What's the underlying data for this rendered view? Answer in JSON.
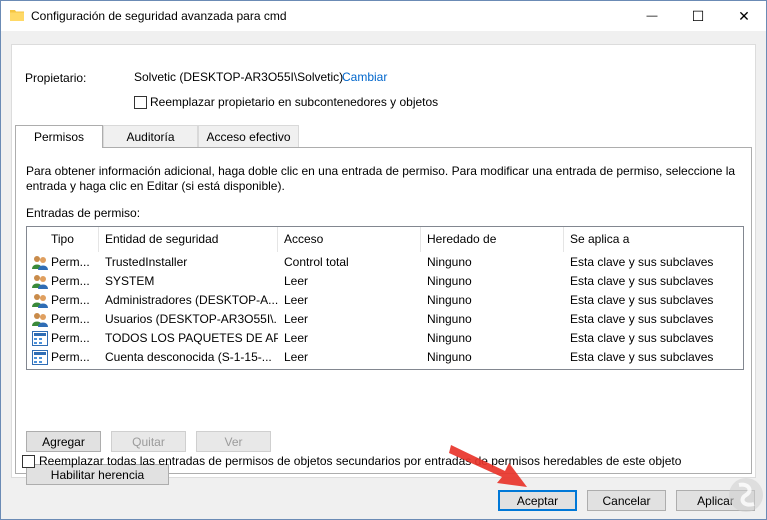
{
  "window": {
    "title": "Configuración de seguridad avanzada para cmd",
    "minimize_glyph": "—",
    "maximize_glyph": "☐",
    "close_glyph": "✕"
  },
  "owner": {
    "label": "Propietario:",
    "value": "Solvetic (DESKTOP-AR3O55I\\Solvetic)",
    "change_link": "Cambiar",
    "replace_checkbox_label": "Reemplazar propietario en subcontenedores y objetos"
  },
  "tabs": [
    {
      "label": "Permisos",
      "active": true
    },
    {
      "label": "Auditoría",
      "active": false
    },
    {
      "label": "Acceso efectivo",
      "active": false
    }
  ],
  "permissions": {
    "info_text": "Para obtener información adicional, haga doble clic en una entrada de permiso. Para modificar una entrada de permiso, seleccione la entrada y haga clic en Editar (si está disponible).",
    "entries_label": "Entradas de permiso:",
    "columns": [
      "Tipo",
      "Entidad de seguridad",
      "Acceso",
      "Heredado de",
      "Se aplica a"
    ],
    "rows": [
      {
        "icon": "users-icon",
        "tipo": "Perm...",
        "entidad": "TrustedInstaller",
        "acceso": "Control total",
        "heredado": "Ninguno",
        "aplica": "Esta clave y sus subclaves"
      },
      {
        "icon": "users-icon",
        "tipo": "Perm...",
        "entidad": "SYSTEM",
        "acceso": "Leer",
        "heredado": "Ninguno",
        "aplica": "Esta clave y sus subclaves"
      },
      {
        "icon": "users-icon",
        "tipo": "Perm...",
        "entidad": "Administradores (DESKTOP-A...",
        "acceso": "Leer",
        "heredado": "Ninguno",
        "aplica": "Esta clave y sus subclaves"
      },
      {
        "icon": "users-icon",
        "tipo": "Perm...",
        "entidad": "Usuarios (DESKTOP-AR3O55I\\...",
        "acceso": "Leer",
        "heredado": "Ninguno",
        "aplica": "Esta clave y sus subclaves"
      },
      {
        "icon": "app-package-icon",
        "tipo": "Perm...",
        "entidad": "TODOS LOS PAQUETES DE AP...",
        "acceso": "Leer",
        "heredado": "Ninguno",
        "aplica": "Esta clave y sus subclaves"
      },
      {
        "icon": "app-package-icon",
        "tipo": "Perm...",
        "entidad": "Cuenta desconocida (S-1-15-...",
        "acceso": "Leer",
        "heredado": "Ninguno",
        "aplica": "Esta clave y sus subclaves"
      }
    ],
    "add_button": "Agregar",
    "remove_button": "Quitar",
    "view_button": "Ver",
    "enable_inheritance_button": "Habilitar herencia",
    "replace_all_label": "Reemplazar todas las entradas de permisos de objetos secundarios por entradas de permisos heredables de este objeto"
  },
  "footer": {
    "accept_button": "Aceptar",
    "cancel_button": "Cancelar",
    "apply_button": "Aplicar"
  },
  "colors": {
    "link": "#0066cc",
    "accent": "#0078d7",
    "arrow": "#e8342a"
  }
}
